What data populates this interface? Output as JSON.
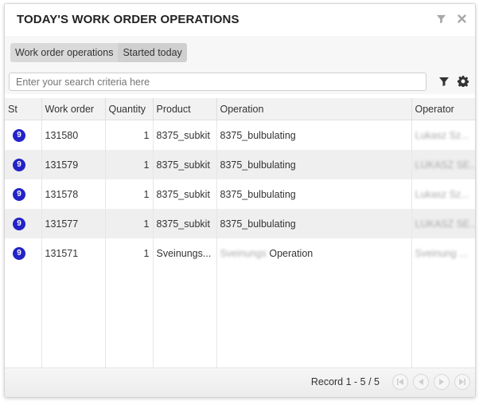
{
  "header": {
    "title": "TODAY'S WORK ORDER OPERATIONS",
    "icons": [
      "filter-icon",
      "close-icon"
    ]
  },
  "breadcrumb": [
    {
      "label": "Work order operations"
    },
    {
      "label": "Started today"
    }
  ],
  "search": {
    "placeholder": "Enter your search criteria here",
    "value": ""
  },
  "toolbar_icons": [
    "filter-icon",
    "gear-icon"
  ],
  "table": {
    "columns": [
      "St",
      "Work order",
      "Quantity",
      "Product",
      "Operation",
      "Operator"
    ],
    "rows": [
      {
        "status": "9",
        "work_order": "131580",
        "quantity": "1",
        "product": "8375_subkit",
        "operation": "8375_bulbulating",
        "operation_blur": "",
        "operator": "Lukasz Sz..."
      },
      {
        "status": "9",
        "work_order": "131579",
        "quantity": "1",
        "product": "8375_subkit",
        "operation": "8375_bulbulating",
        "operation_blur": "",
        "operator": "LUKASZ SE..."
      },
      {
        "status": "9",
        "work_order": "131578",
        "quantity": "1",
        "product": "8375_subkit",
        "operation": "8375_bulbulating",
        "operation_blur": "",
        "operator": "Lukasz Sz..."
      },
      {
        "status": "9",
        "work_order": "131577",
        "quantity": "1",
        "product": "8375_subkit",
        "operation": "8375_bulbulating",
        "operation_blur": "",
        "operator": "LUKASZ SE..."
      },
      {
        "status": "9",
        "work_order": "131571",
        "quantity": "1",
        "product": "Sveinungs...",
        "operation": " Operation",
        "operation_blur": "Sveinungs",
        "operator": "Sveinung ..."
      }
    ],
    "status_color": "#2323c8"
  },
  "footer": {
    "record_text": "Record 1 - 5 / 5",
    "pager": [
      "first-page",
      "previous-page",
      "next-page",
      "last-page"
    ]
  }
}
